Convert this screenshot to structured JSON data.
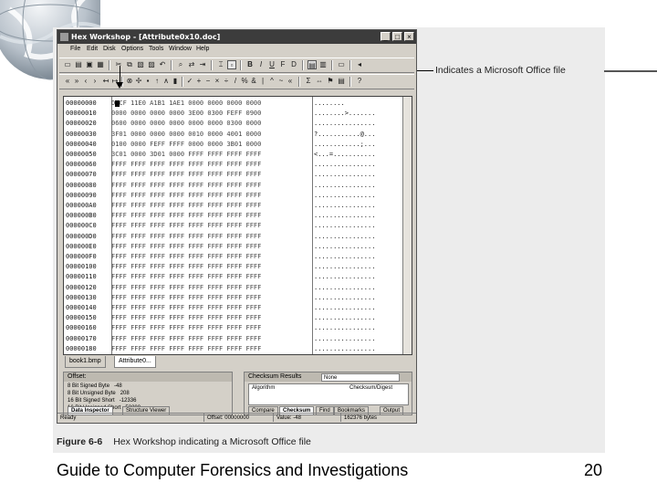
{
  "window": {
    "title": "Hex Workshop - [Attribute0x10.doc]",
    "controls": {
      "minimize": "_",
      "maximize": "□",
      "close": "×"
    }
  },
  "menu": [
    "File",
    "Edit",
    "Disk",
    "Options",
    "Tools",
    "Window",
    "Help"
  ],
  "toolbar1": {
    "format_buttons": [
      "B",
      "I",
      "U",
      "F",
      "D"
    ]
  },
  "hex_rows": [
    {
      "offset": "00000000",
      "hex": "D0CF 11E0 A1B1 1AE1 0000 0000 0000 0000",
      "ascii": "........"
    },
    {
      "offset": "00000010",
      "hex": "0000 0000 0000 0000 3E00 0300 FEFF 0900",
      "ascii": "........>......."
    },
    {
      "offset": "00000020",
      "hex": "0600 0000 0000 0000 0000 0000 0300 0000",
      "ascii": "................"
    },
    {
      "offset": "00000030",
      "hex": "3F01 0000 0000 0000 0010 0000 4001 0000",
      "ascii": "?...........@..."
    },
    {
      "offset": "00000040",
      "hex": "0100 0000 FEFF FFFF 0000 0000 3B01 0000",
      "ascii": "............;..."
    },
    {
      "offset": "00000050",
      "hex": "3C01 0000 3D01 0000 FFFF FFFF FFFF FFFF",
      "ascii": "<...=..........."
    },
    {
      "offset": "00000060",
      "hex": "FFFF FFFF FFFF FFFF FFFF FFFF FFFF FFFF",
      "ascii": "................"
    },
    {
      "offset": "00000070",
      "hex": "FFFF FFFF FFFF FFFF FFFF FFFF FFFF FFFF",
      "ascii": "................"
    },
    {
      "offset": "00000080",
      "hex": "FFFF FFFF FFFF FFFF FFFF FFFF FFFF FFFF",
      "ascii": "................"
    },
    {
      "offset": "00000090",
      "hex": "FFFF FFFF FFFF FFFF FFFF FFFF FFFF FFFF",
      "ascii": "................"
    },
    {
      "offset": "000000A0",
      "hex": "FFFF FFFF FFFF FFFF FFFF FFFF FFFF FFFF",
      "ascii": "................"
    },
    {
      "offset": "000000B0",
      "hex": "FFFF FFFF FFFF FFFF FFFF FFFF FFFF FFFF",
      "ascii": "................"
    },
    {
      "offset": "000000C0",
      "hex": "FFFF FFFF FFFF FFFF FFFF FFFF FFFF FFFF",
      "ascii": "................"
    },
    {
      "offset": "000000D0",
      "hex": "FFFF FFFF FFFF FFFF FFFF FFFF FFFF FFFF",
      "ascii": "................"
    },
    {
      "offset": "000000E0",
      "hex": "FFFF FFFF FFFF FFFF FFFF FFFF FFFF FFFF",
      "ascii": "................"
    },
    {
      "offset": "000000F0",
      "hex": "FFFF FFFF FFFF FFFF FFFF FFFF FFFF FFFF",
      "ascii": "................"
    },
    {
      "offset": "00000100",
      "hex": "FFFF FFFF FFFF FFFF FFFF FFFF FFFF FFFF",
      "ascii": "................"
    },
    {
      "offset": "00000110",
      "hex": "FFFF FFFF FFFF FFFF FFFF FFFF FFFF FFFF",
      "ascii": "................"
    },
    {
      "offset": "00000120",
      "hex": "FFFF FFFF FFFF FFFF FFFF FFFF FFFF FFFF",
      "ascii": "................"
    },
    {
      "offset": "00000130",
      "hex": "FFFF FFFF FFFF FFFF FFFF FFFF FFFF FFFF",
      "ascii": "................"
    },
    {
      "offset": "00000140",
      "hex": "FFFF FFFF FFFF FFFF FFFF FFFF FFFF FFFF",
      "ascii": "................"
    },
    {
      "offset": "00000150",
      "hex": "FFFF FFFF FFFF FFFF FFFF FFFF FFFF FFFF",
      "ascii": "................"
    },
    {
      "offset": "00000160",
      "hex": "FFFF FFFF FFFF FFFF FFFF FFFF FFFF FFFF",
      "ascii": "................"
    },
    {
      "offset": "00000170",
      "hex": "FFFF FFFF FFFF FFFF FFFF FFFF FFFF FFFF",
      "ascii": "................"
    },
    {
      "offset": "00000180",
      "hex": "FFFF FFFF FFFF FFFF FFFF FFFF FFFF FFFF",
      "ascii": "................"
    }
  ],
  "file_tabs": [
    "book1.bmp",
    "Attribute0..."
  ],
  "data_inspector": {
    "header": "Offset:",
    "rows": [
      {
        "type": "8 Bit Signed Byte",
        "value": "-48"
      },
      {
        "type": "8 Bit Unsigned Byte",
        "value": "208"
      },
      {
        "type": "16 Bit Signed Short",
        "value": "-12336"
      },
      {
        "type": "16 Bit Unsigned Short",
        "value": "53200"
      }
    ],
    "tabs": [
      "Data Inspector",
      "Structure Viewer"
    ]
  },
  "checksum_panel": {
    "header": "Checksum Results",
    "select_value": "None",
    "columns": [
      "Algorithm",
      "Checksum/Digest"
    ],
    "tabs": [
      "Compare",
      "Checksum",
      "Find",
      "Bookmarks",
      "Output"
    ]
  },
  "status": {
    "left": "Ready",
    "offset": "Offset: 00000000",
    "value": "Value: -48",
    "size": "162376 bytes"
  },
  "callout": "Indicates a Microsoft Office file",
  "caption": {
    "figure": "Figure 6-6",
    "text": "Hex Workshop indicating a Microsoft Office file"
  },
  "footer": {
    "title": "Guide to Computer Forensics and Investigations",
    "page": "20"
  }
}
